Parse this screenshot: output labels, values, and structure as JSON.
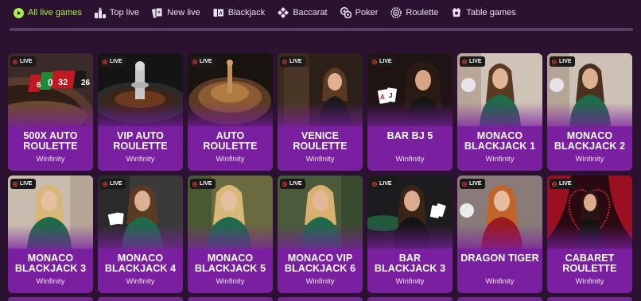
{
  "nav": {
    "items": [
      {
        "label": "All live games",
        "icon": "play-circle-icon",
        "active": true
      },
      {
        "label": "Top live",
        "icon": "podium-icon",
        "active": false
      },
      {
        "label": "New live",
        "icon": "new-cards-icon",
        "active": false
      },
      {
        "label": "Blackjack",
        "icon": "playing-cards-icon",
        "active": false
      },
      {
        "label": "Baccarat",
        "icon": "diamonds-icon",
        "active": false
      },
      {
        "label": "Poker",
        "icon": "poker-chips-icon",
        "active": false
      },
      {
        "label": "Roulette",
        "icon": "roulette-wheel-icon",
        "active": false
      },
      {
        "label": "Table games",
        "icon": "table-games-icon",
        "active": false
      }
    ],
    "active_color": "#a7f04a"
  },
  "live_badge": "LIVE",
  "games": [
    {
      "title": "500X AUTO ROULETTE",
      "provider": "Winfinity",
      "art": "roulette-wheel"
    },
    {
      "title": "VIP AUTO ROULETTE",
      "provider": "Winfinity",
      "art": "roulette-top"
    },
    {
      "title": "AUTO ROULETTE",
      "provider": "Winfinity",
      "art": "roulette-wood"
    },
    {
      "title": "VENICE ROULETTE",
      "provider": "Winfinity",
      "art": "dealer-venice"
    },
    {
      "title": "BAR BJ 5",
      "provider": "Winfinity",
      "art": "dealer-cards"
    },
    {
      "title": "MONACO BLACKJACK 1",
      "provider": "Winfinity",
      "art": "dealer-green"
    },
    {
      "title": "MONACO BLACKJACK 2",
      "provider": "Winfinity",
      "art": "dealer-green"
    },
    {
      "title": "MONACO BLACKJACK 3",
      "provider": "Winfinity",
      "art": "dealer-blonde"
    },
    {
      "title": "MONACO BLACKJACK 4",
      "provider": "Winfinity",
      "art": "dealer-green"
    },
    {
      "title": "MONACO BLACKJACK 5",
      "provider": "Winfinity",
      "art": "dealer-blonde"
    },
    {
      "title": "MONACO VIP BLACKJACK 6",
      "provider": "Winfinity",
      "art": "dealer-green"
    },
    {
      "title": "BAR BLACKJACK 3",
      "provider": "Winfinity",
      "art": "dealer-bar"
    },
    {
      "title": "DRAGON TIGER",
      "provider": "Winfinity",
      "art": "dealer-red"
    },
    {
      "title": "CABARET ROULETTE",
      "provider": "Winfinity",
      "art": "dealer-cabaret"
    }
  ]
}
